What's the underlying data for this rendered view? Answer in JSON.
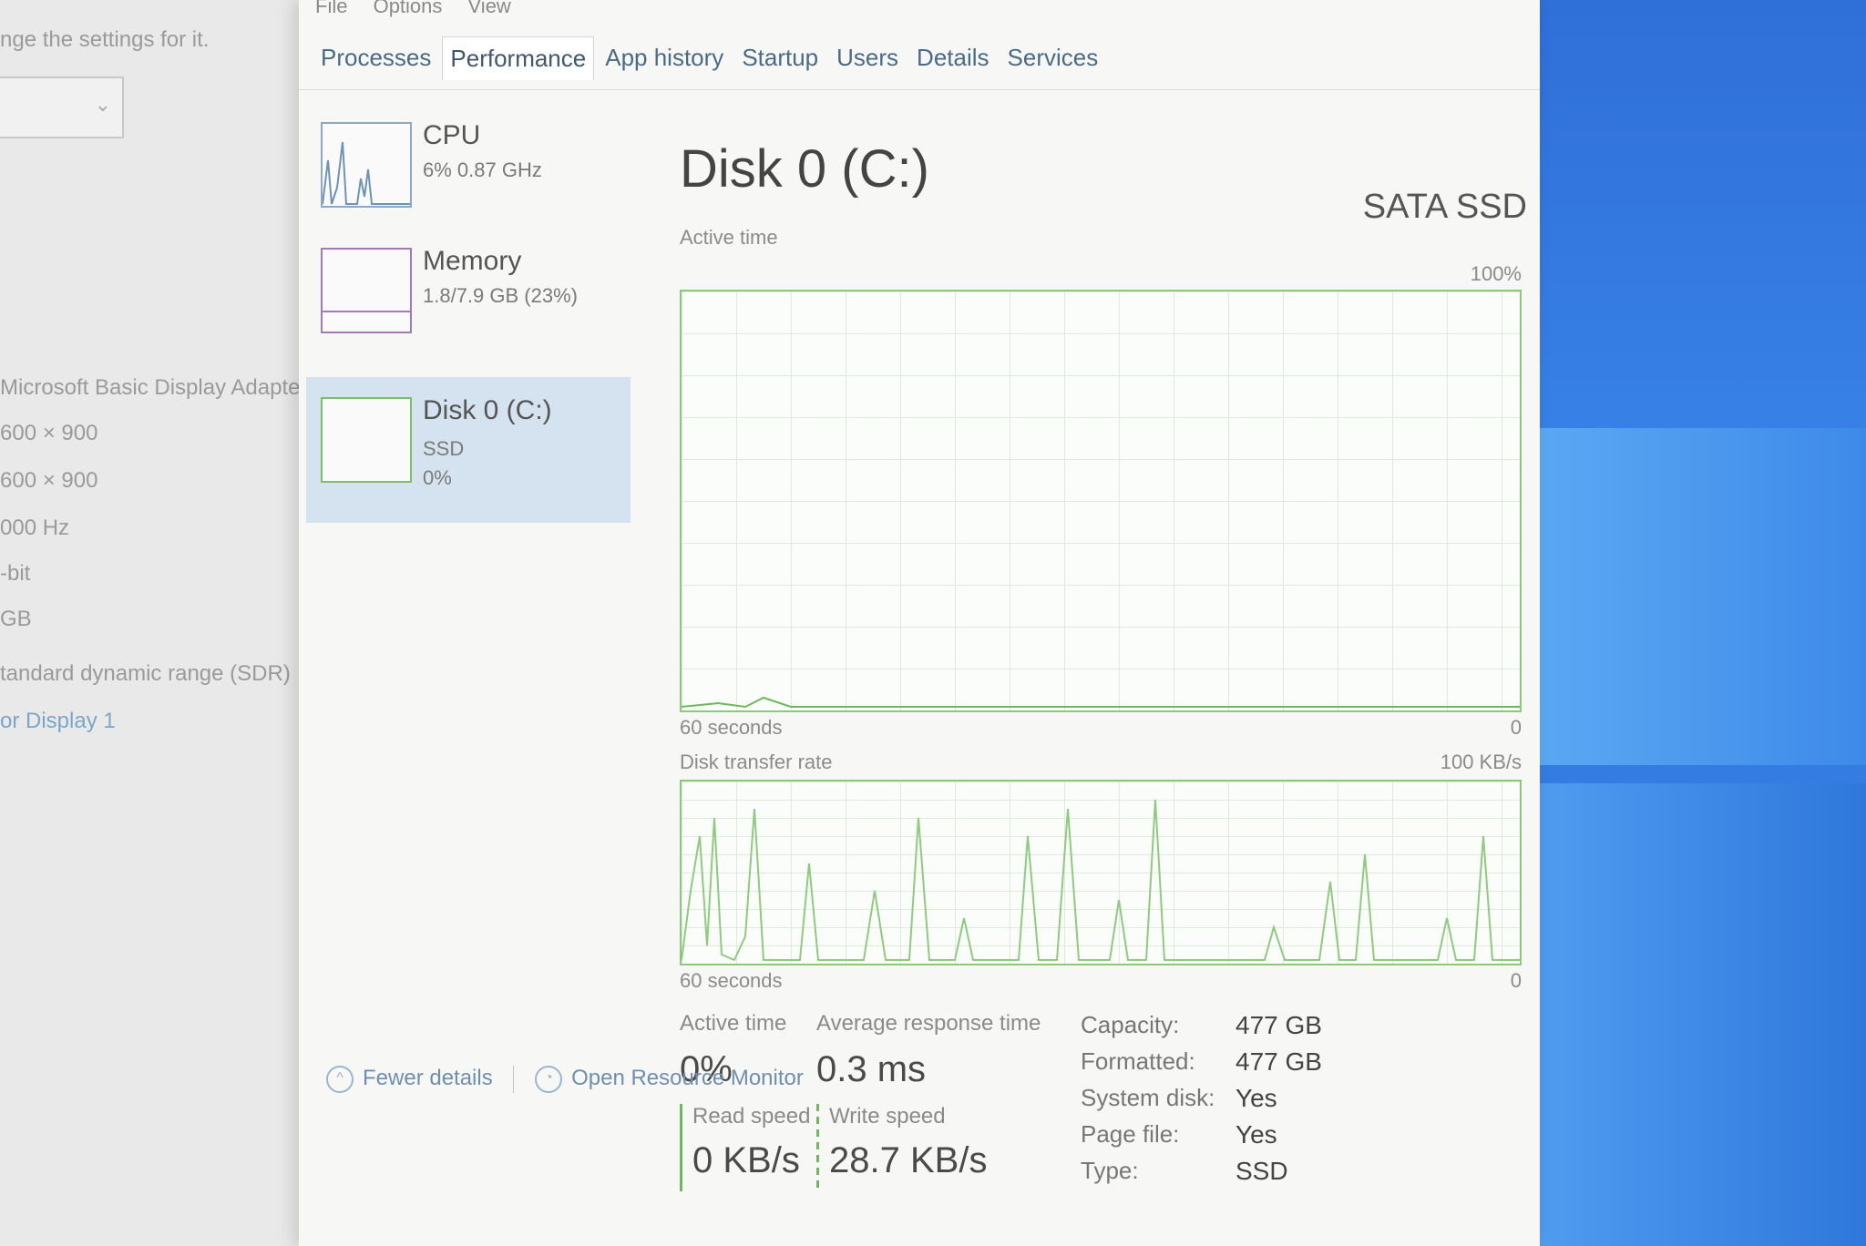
{
  "background_settings": {
    "lines": [
      "nge the settings for it.",
      "Microsoft Basic Display Adapter",
      "600 × 900",
      "600 × 900",
      "000 Hz",
      "-bit",
      "GB",
      "tandard dynamic range (SDR)",
      "or Display 1"
    ],
    "dropdown_chevron": "⌄"
  },
  "menu": [
    "File",
    "Options",
    "View"
  ],
  "tabs": [
    {
      "label": "Processes"
    },
    {
      "label": "Performance",
      "active": true
    },
    {
      "label": "App history"
    },
    {
      "label": "Startup"
    },
    {
      "label": "Users"
    },
    {
      "label": "Details"
    },
    {
      "label": "Services"
    }
  ],
  "sidebar": {
    "cpu": {
      "title": "CPU",
      "sub": "6% 0.87 GHz"
    },
    "memory": {
      "title": "Memory",
      "sub": "1.8/7.9 GB (23%)"
    },
    "disk": {
      "title": "Disk 0 (C:)",
      "sub1": "SSD",
      "sub2": "0%"
    }
  },
  "main": {
    "title": "Disk 0 (C:)",
    "disk_type": "SATA SSD",
    "active_time_chart": {
      "label": "Active time",
      "max_label": "100%",
      "min_label": "0",
      "duration_label": "60 seconds"
    },
    "transfer_chart": {
      "label": "Disk transfer rate",
      "max_label": "100 KB/s",
      "min_label": "0",
      "duration_label": "60 seconds"
    },
    "stats": {
      "active_time_label": "Active time",
      "active_time_value": "0%",
      "avg_response_label": "Average response time",
      "avg_response_value": "0.3 ms",
      "read_speed_label": "Read speed",
      "read_speed_value": "0 KB/s",
      "write_speed_label": "Write speed",
      "write_speed_value": "28.7 KB/s"
    },
    "properties": {
      "capacity_label": "Capacity:",
      "capacity_value": "477 GB",
      "formatted_label": "Formatted:",
      "formatted_value": "477 GB",
      "system_disk_label": "System disk:",
      "system_disk_value": "Yes",
      "page_file_label": "Page file:",
      "page_file_value": "Yes",
      "type_label": "Type:",
      "type_value": "SSD"
    }
  },
  "footer": {
    "fewer_details": "Fewer details",
    "open_resource_monitor": "Open Resource Monitor"
  },
  "colors": {
    "disk_green": "#6cb85c",
    "selected_bg": "#d4e3ef",
    "link": "#6f8fb0"
  }
}
